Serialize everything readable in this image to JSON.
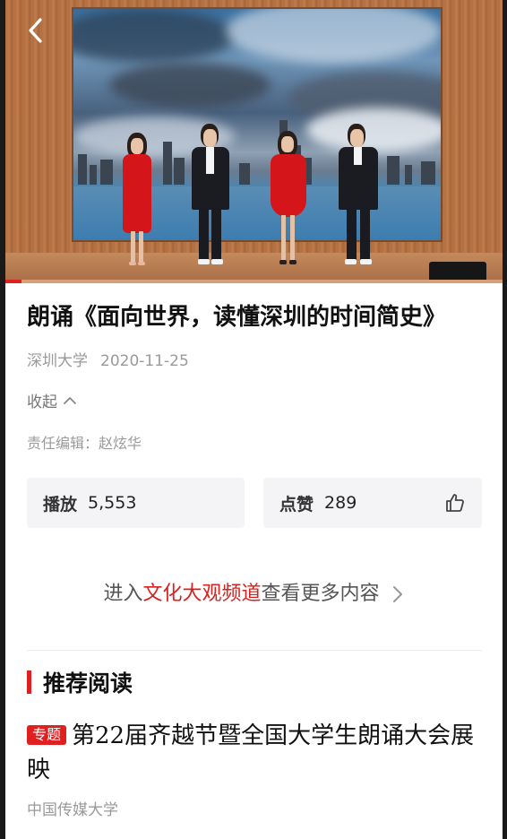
{
  "video": {
    "back_icon": "chevron-left-icon",
    "progress_color": "#e02020"
  },
  "article": {
    "title": "朗诵《面向世界，读懂深圳的时间简史》",
    "source": "深圳大学",
    "date": "2020-11-25",
    "collapse_label": "收起",
    "editor": "责任编辑：赵炫华"
  },
  "stats": {
    "play_label": "播放",
    "play_count": "5,553",
    "like_label": "点赞",
    "like_count": "289",
    "like_icon": "thumbs-up-icon"
  },
  "channel_link": {
    "prefix": "进入",
    "highlight": "文化大观频道",
    "suffix": "查看更多内容",
    "highlight_color": "#d8201f"
  },
  "recommended": {
    "section_title": "推荐阅读",
    "items": [
      {
        "badge": "专题",
        "title": "第22届齐越节暨全国大学生朗诵大会展映",
        "source": "中国传媒大学"
      }
    ]
  }
}
